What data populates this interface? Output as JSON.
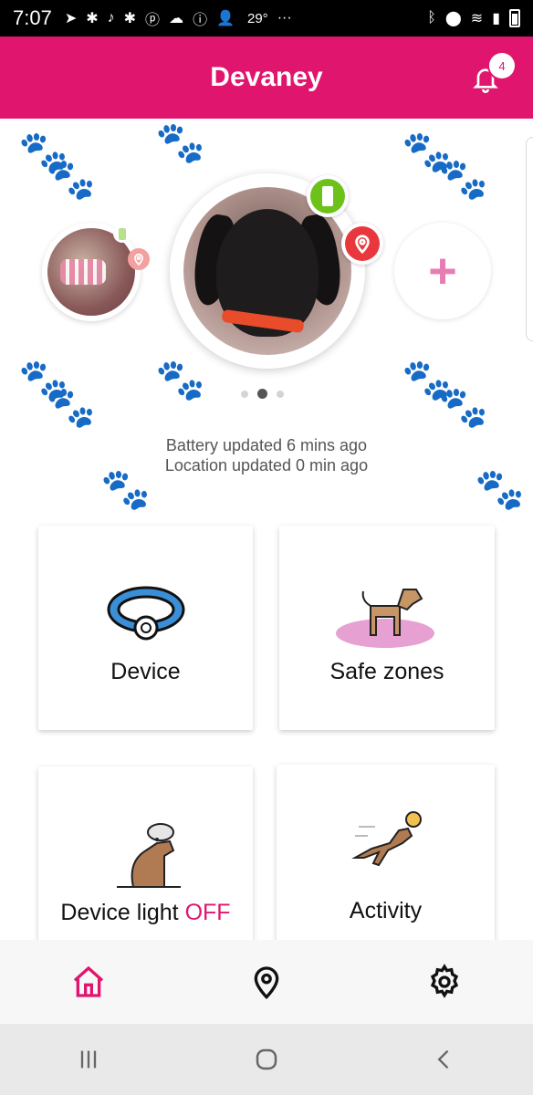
{
  "status_bar": {
    "time": "7:07",
    "temperature": "29°",
    "more": "···"
  },
  "header": {
    "title": "Devaney",
    "notification_count": "4"
  },
  "pets": {
    "carousel_index_count": 3,
    "active_index": 1,
    "add_label": "+"
  },
  "updates": {
    "battery": "Battery updated 6 mins ago",
    "location": "Location updated 0 min ago"
  },
  "cards": {
    "device": "Device",
    "safe_zones": "Safe zones",
    "device_light_label": "Device light",
    "device_light_state": "OFF",
    "activity": "Activity"
  },
  "bottom_nav": {
    "items": [
      "home-icon",
      "location-pin-icon",
      "gear-icon"
    ],
    "active": "home-icon"
  },
  "colors": {
    "brand": "#E0166E",
    "battery_green": "#6dc21a",
    "location_red": "#e8383d",
    "add_pink": "#e77db2"
  }
}
